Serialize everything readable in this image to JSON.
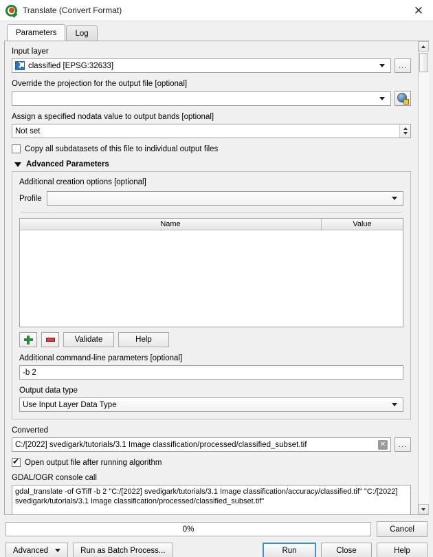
{
  "window": {
    "title": "Translate (Convert Format)",
    "logo_icon": "qgis-logo-icon",
    "close_icon": "close-icon"
  },
  "tabs": [
    {
      "label": "Parameters",
      "active": true
    },
    {
      "label": "Log",
      "active": false
    }
  ],
  "form": {
    "input_layer": {
      "label": "Input layer",
      "value": "classified [EPSG:32633]",
      "layer_icon": "raster-layer-icon",
      "browse_label": "...",
      "dropdown_icon": "chevron-down-icon"
    },
    "override_projection": {
      "label": "Override the projection for the output file [optional]",
      "value": "",
      "crs_icon": "crs-globe-icon",
      "dropdown_icon": "chevron-down-icon"
    },
    "nodata": {
      "label": "Assign a specified nodata value to output bands [optional]",
      "value": "Not set",
      "spinner_up_icon": "spinner-up-icon",
      "spinner_down_icon": "spinner-down-icon"
    },
    "copy_subdatasets": {
      "label": "Copy all subdatasets of this file to individual output files",
      "checked": false
    },
    "advanced": {
      "header": "Advanced Parameters",
      "collapse_icon": "triangle-down-icon",
      "creation_options_label": "Additional creation options [optional]",
      "profile": {
        "label": "Profile",
        "value": "",
        "dropdown_icon": "chevron-down-icon"
      },
      "table": {
        "columns": [
          "Name",
          "Value"
        ],
        "rows": []
      },
      "buttons": {
        "add_icon": "add-row-icon",
        "remove_icon": "remove-row-icon",
        "validate": "Validate",
        "help": "Help"
      },
      "extra_params": {
        "label": "Additional command-line parameters [optional]",
        "value": "-b 2"
      },
      "output_data_type": {
        "label": "Output data type",
        "value": "Use Input Layer Data Type",
        "dropdown_icon": "chevron-down-icon"
      }
    },
    "converted": {
      "label": "Converted",
      "value": "C:/[2022] svedigark/tutorials/3.1 Image classification/processed/classified_subset.tif",
      "clear_icon": "clear-icon",
      "browse_label": "..."
    },
    "open_output": {
      "label": "Open output file after running algorithm",
      "checked": true
    },
    "console": {
      "label": "GDAL/OGR console call",
      "value": "gdal_translate -of GTiff -b 2 \"C:/[2022] svedigark/tutorials/3.1 Image classification/accuracy/classified.tif\" \"C:/[2022] svedigark/tutorials/3.1 Image classification/processed/classified_subset.tif\""
    }
  },
  "scrollbar": {
    "up_icon": "scroll-up-icon",
    "down_icon": "scroll-down-icon"
  },
  "footer": {
    "progress_text": "0%",
    "cancel": "Cancel",
    "advanced": "Advanced",
    "advanced_dropdown_icon": "chevron-down-icon",
    "run_batch": "Run as Batch Process...",
    "run": "Run",
    "close": "Close",
    "help": "Help"
  }
}
